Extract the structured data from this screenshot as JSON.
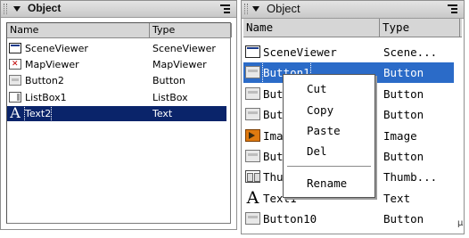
{
  "left_panel": {
    "title": "Object",
    "columns": {
      "name": "Name",
      "type": "Type"
    },
    "rows": [
      {
        "name": "SceneViewer",
        "type": "SceneViewer",
        "icon": "scene-viewer-icon"
      },
      {
        "name": "MapViewer",
        "type": "MapViewer",
        "icon": "map-viewer-icon"
      },
      {
        "name": "Button2",
        "type": "Button",
        "icon": "button-icon"
      },
      {
        "name": "ListBox1",
        "type": "ListBox",
        "icon": "listbox-icon"
      },
      {
        "name": "Text2",
        "type": "Text",
        "icon": "text-icon",
        "selected": true
      }
    ]
  },
  "right_panel": {
    "title": "Object",
    "columns": {
      "name": "Name",
      "type": "Type"
    },
    "rows": [
      {
        "name": "SceneViewer",
        "type": "Scene...",
        "icon": "scene-viewer-icon"
      },
      {
        "name": "Button1",
        "type": "Button",
        "icon": "button-icon",
        "selected": true
      },
      {
        "name": "But",
        "type": "Button",
        "icon": "button-icon"
      },
      {
        "name": "But",
        "type": "Button",
        "icon": "button-icon"
      },
      {
        "name": "Ima",
        "type": "Image",
        "icon": "image-icon"
      },
      {
        "name": "But",
        "type": "Button",
        "icon": "button-icon"
      },
      {
        "name": "Thu",
        "type": "Thumb...",
        "icon": "thumbnail-icon"
      },
      {
        "name": "Text1",
        "type": "Text",
        "icon": "text-icon"
      },
      {
        "name": "Button10",
        "type": "Button",
        "icon": "button-icon"
      }
    ]
  },
  "context_menu": {
    "items": [
      "Cut",
      "Copy",
      "Paste",
      "Del"
    ],
    "after_separator": [
      "Rename"
    ]
  },
  "colors": {
    "selection_dark": "#0a246a",
    "selection_blue": "#2b6bc8",
    "header_bg": "#d6d6d6"
  }
}
